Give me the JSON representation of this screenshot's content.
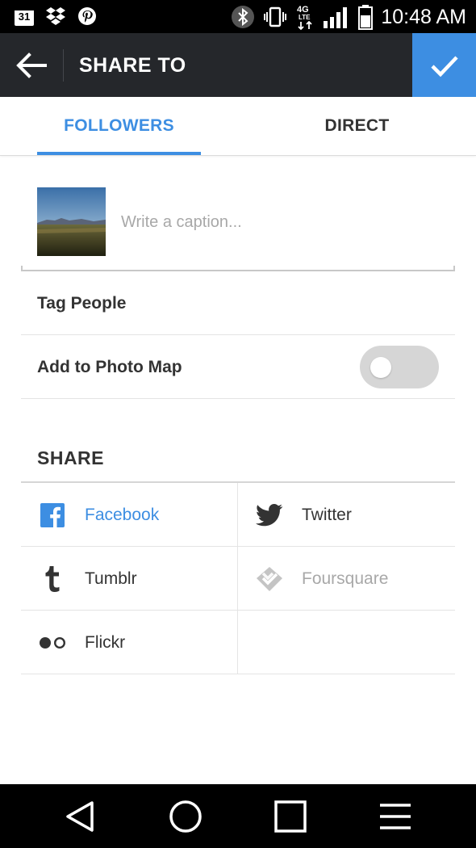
{
  "status_bar": {
    "calendar_day": "31",
    "time": "10:48 AM",
    "network": "4G LTE",
    "left_icons": [
      "calendar-icon",
      "dropbox-icon",
      "pinterest-icon"
    ],
    "right_icons": [
      "bluetooth-icon",
      "vibrate-icon",
      "lte-icon",
      "signal-icon",
      "battery-icon"
    ]
  },
  "header": {
    "title": "SHARE TO",
    "back_icon": "arrow-left-icon",
    "confirm_icon": "check-icon",
    "colors": {
      "bar": "#25272b",
      "confirm": "#3d8ee2"
    }
  },
  "tabs": [
    {
      "label": "FOLLOWERS",
      "active": true
    },
    {
      "label": "DIRECT",
      "active": false
    }
  ],
  "caption": {
    "placeholder": "Write a caption...",
    "value": ""
  },
  "options": {
    "tag_people": "Tag People",
    "photo_map": "Add to Photo Map",
    "photo_map_enabled": false
  },
  "share": {
    "heading": "SHARE",
    "services": [
      {
        "label": "Facebook",
        "icon": "facebook-icon"
      },
      {
        "label": "Twitter",
        "icon": "twitter-icon"
      },
      {
        "label": "Tumblr",
        "icon": "tumblr-icon"
      },
      {
        "label": "Foursquare",
        "icon": "foursquare-icon"
      },
      {
        "label": "Flickr",
        "icon": "flickr-icon"
      }
    ]
  },
  "nav": [
    "back-nav-icon",
    "home-nav-icon",
    "recents-nav-icon",
    "menu-nav-icon"
  ]
}
